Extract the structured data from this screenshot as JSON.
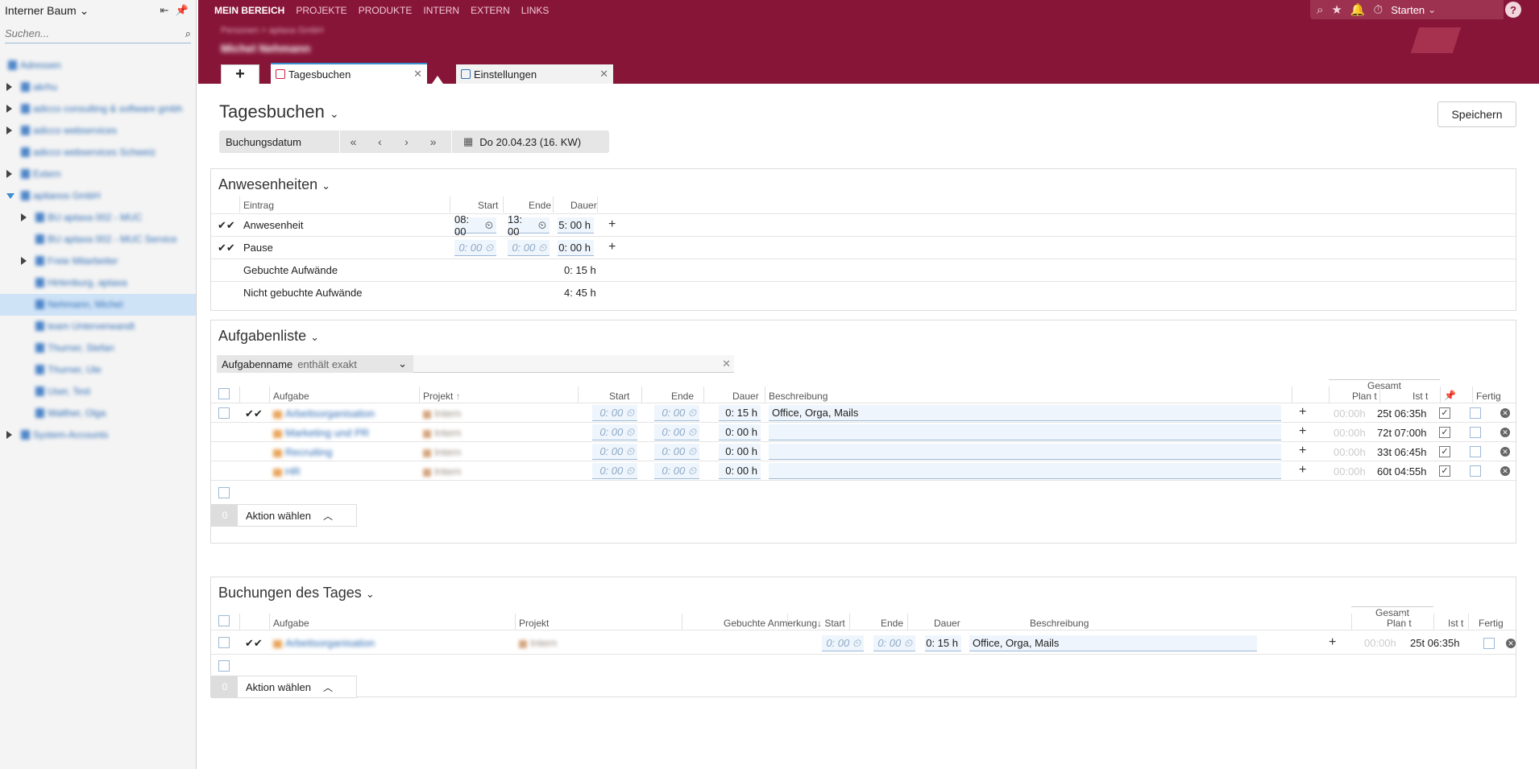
{
  "sidebar": {
    "title": "Interner Baum",
    "search_placeholder": "Suchen...",
    "tree": [
      {
        "label": "Adressen"
      },
      {
        "label": "akrhu"
      },
      {
        "label": "adicco consulting & software gmbh"
      },
      {
        "label": "adicco webservices"
      },
      {
        "label": "adicco webservices Schweiz"
      },
      {
        "label": "Extern"
      },
      {
        "label": "apitanos GmbH"
      },
      {
        "label": "BU aptaxa 002 - MUC"
      },
      {
        "label": "BU aptaxa 002 - MUC Service"
      },
      {
        "label": "Freie Mitarbeiter"
      },
      {
        "label": "Hirtenburg, aptaxa"
      },
      {
        "label": "Nehmann, Michel"
      },
      {
        "label": "team Unterverwandt"
      },
      {
        "label": "Thurner, Stefan"
      },
      {
        "label": "Thurner, Ute"
      },
      {
        "label": "User, Test"
      },
      {
        "label": "Walther, Olga"
      },
      {
        "label": "System-Accounts"
      }
    ]
  },
  "header": {
    "nav": [
      "MEIN BEREICH",
      "PROJEKTE",
      "PRODUKTE",
      "INTERN",
      "EXTERN",
      "LINKS"
    ],
    "crumb": "Personen  >  aptaxa GmbH",
    "user": "Michel Nehmann",
    "starten": "Starten",
    "help": "?"
  },
  "tabs": [
    {
      "label": "Tagesbuchen"
    },
    {
      "label": "Einstellungen"
    }
  ],
  "page": {
    "title": "Tagesbuchen",
    "save": "Speichern",
    "date_label": "Buchungsdatum",
    "date_value": "Do 20.04.23 (16. KW)"
  },
  "anwesenheiten": {
    "title": "Anwesenheiten",
    "cols": [
      "Eintrag",
      "Start",
      "Ende",
      "Dauer"
    ],
    "rows": [
      {
        "name": "Anwesenheit",
        "start": "08: 00",
        "end": "13: 00",
        "dur": "5: 00",
        "unit": "h"
      },
      {
        "name": "Pause",
        "start": "0: 00",
        "end": "0: 00",
        "dur": "0: 00",
        "unit": "h"
      },
      {
        "name": "Gebuchte Aufwände",
        "dur": "0: 15 h"
      },
      {
        "name": "Nicht gebuchte Aufwände",
        "dur": "4: 45 h"
      }
    ]
  },
  "aufgaben": {
    "title": "Aufgabenliste",
    "filter_label": "Aufgabenname",
    "filter_op": "enthält exakt",
    "gesamt": "Gesamt",
    "cols": [
      "Aufgabe",
      "Projekt",
      "Start",
      "Ende",
      "Dauer",
      "Beschreibung",
      "Plan t",
      "Ist t",
      "Fertig"
    ],
    "rows": [
      {
        "task": "Arbeitsorganisation",
        "project": "Intern",
        "start": "0: 00",
        "end": "0: 00",
        "dur": "0: 15",
        "desc": "Office, Orga, Mails",
        "plan": "00:00h",
        "ist": "25t 06:35h"
      },
      {
        "task": "Marketing und PR",
        "project": "Intern",
        "start": "0: 00",
        "end": "0: 00",
        "dur": "0: 00",
        "desc": "",
        "plan": "00:00h",
        "ist": "72t 07:00h"
      },
      {
        "task": "Recruiting",
        "project": "Intern",
        "start": "0: 00",
        "end": "0: 00",
        "dur": "0: 00",
        "desc": "",
        "plan": "00:00h",
        "ist": "33t 06:45h"
      },
      {
        "task": "HR",
        "project": "Intern",
        "start": "0: 00",
        "end": "0: 00",
        "dur": "0: 00",
        "desc": "",
        "plan": "00:00h",
        "ist": "60t 04:55h"
      }
    ],
    "action_count": "0",
    "action_label": "Aktion wählen"
  },
  "buchungen": {
    "title": "Buchungen des Tages",
    "gesamt": "Gesamt",
    "cols": [
      "Aufgabe",
      "Projekt",
      "Gebuchte Anmerkung",
      "Start",
      "Ende",
      "Dauer",
      "Beschreibung",
      "Plan t",
      "Ist t",
      "Fertig"
    ],
    "rows": [
      {
        "task": "Arbeitsorganisation",
        "project": "Intern",
        "start": "0: 00",
        "end": "0: 00",
        "dur": "0: 15",
        "unit": "h",
        "desc": "Office, Orga, Mails",
        "plan": "00:00h",
        "ist": "25t 06:35h"
      }
    ],
    "action_count": "0",
    "action_label": "Aktion wählen"
  },
  "colors": {
    "brand": "#871538",
    "accent": "#3a8fd1"
  }
}
